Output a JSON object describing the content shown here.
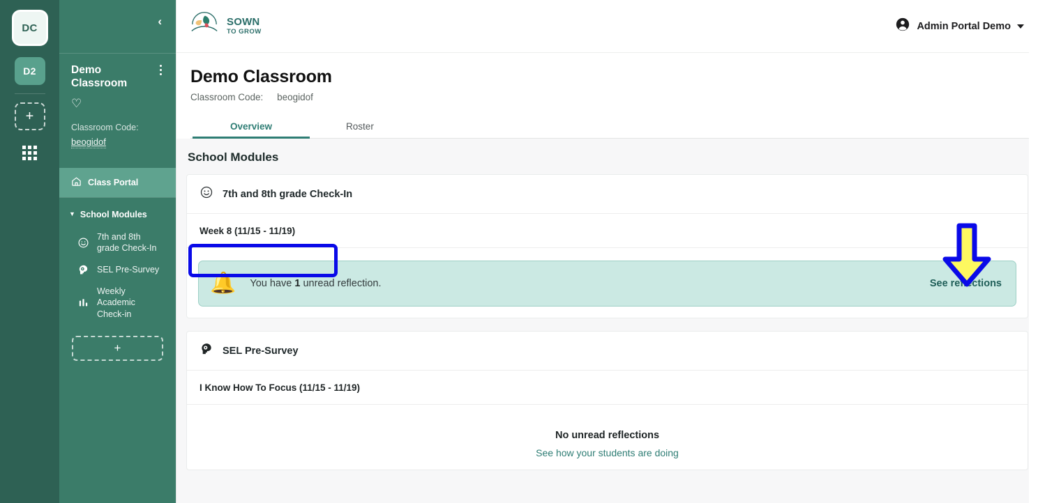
{
  "rail": {
    "avatar_initials": "DC",
    "class_chip": "D2",
    "add_label": "+",
    "apps_icon": "grid-icon"
  },
  "sidebar": {
    "collapse_icon": "chevron-left-icon",
    "class_name": "Demo Classroom",
    "kebab_icon": "kebab-menu-icon",
    "favorite_icon": "heart-icon",
    "code_label": "Classroom Code:",
    "code_value": "beogidof",
    "class_portal": "Class Portal",
    "group_label": "School Modules",
    "modules": [
      {
        "label": "7th and 8th grade Check-In",
        "icon": "smiley-face-icon"
      },
      {
        "label": "SEL Pre-Survey",
        "icon": "head-gear-icon"
      },
      {
        "label": "Weekly Academic Check-in",
        "icon": "bar-chart-icon"
      }
    ],
    "add_module_label": "+"
  },
  "topbar": {
    "brand_line1": "SOWN",
    "brand_line2": "TO GROW",
    "logo_icon": "sown-to-grow-leaf-logo",
    "user_name": "Admin Portal Demo",
    "user_icon": "account-circle-icon",
    "caret_icon": "chevron-down-icon"
  },
  "page": {
    "title": "Demo Classroom",
    "code_label": "Classroom Code:",
    "code_value": "beogidof",
    "tabs": [
      {
        "label": "Overview",
        "active": true
      },
      {
        "label": "Roster",
        "active": false
      }
    ]
  },
  "content": {
    "section_title": "School Modules",
    "modules": [
      {
        "icon": "smiley-face-icon",
        "title": "7th and 8th grade Check-In",
        "row_label": "Week 8 (11/15 - 11/19)",
        "banner": {
          "icon": "ringing-bell-icon",
          "text_before": "You have",
          "count": "1",
          "text_after": "unread reflection.",
          "cta": "See reflections"
        }
      },
      {
        "icon": "head-gear-icon",
        "title": "SEL Pre-Survey",
        "row_label": "I Know How To Focus (11/15 - 11/19)",
        "empty_title": "No unread reflections",
        "empty_sub": "See how your students are doing"
      }
    ]
  },
  "annotations": {
    "highlight_box_target": "Week 8 (11/15 - 11/19)",
    "arrow_direction": "down",
    "box_color": "#0a0ae8",
    "arrow_fill": "#fdf860",
    "arrow_stroke": "#0a0ae8"
  },
  "colors": {
    "rail_bg": "#2e6154",
    "sidebar_bg": "#3b7c69",
    "sidebar_active": "#5fa38f",
    "brand_teal": "#2b6e69",
    "accent_teal": "#2e7d74",
    "banner_bg": "#cbe9e3",
    "page_bg": "#f7f7f8"
  }
}
